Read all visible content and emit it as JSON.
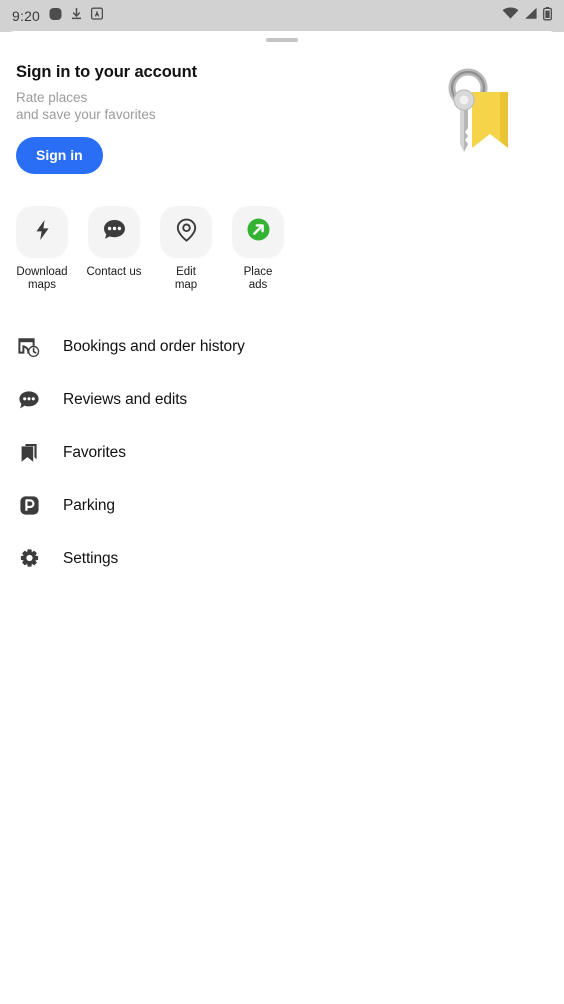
{
  "status_bar": {
    "time": "9:20",
    "left_icons": [
      "rounded-square-icon",
      "download-icon",
      "app-badge-icon"
    ],
    "right_icons": [
      "wifi-icon",
      "cellular-signal-icon",
      "battery-icon"
    ],
    "background_color": "#d2d2d2"
  },
  "sheet": {
    "handle": "drag-handle"
  },
  "account": {
    "title": "Sign in to your account",
    "subtitle_line1": "Rate places",
    "subtitle_line2": "and save your favorites",
    "signin_label": "Sign in",
    "signin_color": "#2a6ef5",
    "illustration": "keys-illustration"
  },
  "quick_actions": [
    {
      "icon": "lightning-bolt-icon",
      "label_line1": "Download",
      "label_line2": "maps"
    },
    {
      "icon": "chat-bubble-icon",
      "label_line1": "Contact us",
      "label_line2": ""
    },
    {
      "icon": "map-pin-icon",
      "label_line1": "Edit",
      "label_line2": "map"
    },
    {
      "icon": "green-arrow-icon",
      "label_line1": "Place",
      "label_line2": "ads",
      "accent_color": "#34b233"
    }
  ],
  "menu_items": [
    {
      "icon": "bookings-history-icon",
      "label": "Bookings and order history"
    },
    {
      "icon": "reviews-chat-icon",
      "label": "Reviews and edits"
    },
    {
      "icon": "bookmark-icon",
      "label": "Favorites"
    },
    {
      "icon": "parking-icon",
      "label": "Parking"
    },
    {
      "icon": "gear-icon",
      "label": "Settings"
    }
  ]
}
